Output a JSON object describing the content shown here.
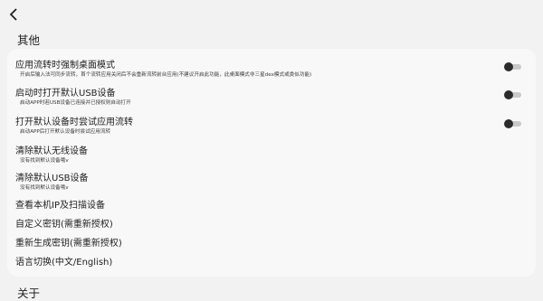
{
  "sections": {
    "other": "其他",
    "about": "关于"
  },
  "items": [
    {
      "title": "应用流转时强制桌面模式",
      "subtitle": "开启后输入法可同步流转，首个流转应用关闭后不会重新流转前台应用(不建议开启此功能，此桌面模式非三星dex模式或类似功能)",
      "toggle": false
    },
    {
      "title": "启动时打开默认USB设备",
      "subtitle": "启动APP时若USB设备已连接并已授权则自动打开",
      "toggle": false
    },
    {
      "title": "打开默认设备时尝试应用流转",
      "subtitle": "启动APP后打开默认设备时尝试应用流转",
      "toggle": false
    },
    {
      "title": "清除默认无线设备",
      "subtitle": "没有找到默认设备哦v"
    },
    {
      "title": "清除默认USB设备",
      "subtitle": "没有找到默认设备哦v"
    },
    {
      "title": "查看本机IP及扫描设备"
    },
    {
      "title": "自定义密钥(需重新授权)"
    },
    {
      "title": "重新生成密钥(需重新授权)"
    },
    {
      "title": "语言切换(中文/English)"
    }
  ],
  "colors": {
    "background": "#f2f2f2",
    "card": "#f8f8f8",
    "toggle_knob": "#2b2b2b",
    "toggle_track": "#c9c9c9"
  }
}
